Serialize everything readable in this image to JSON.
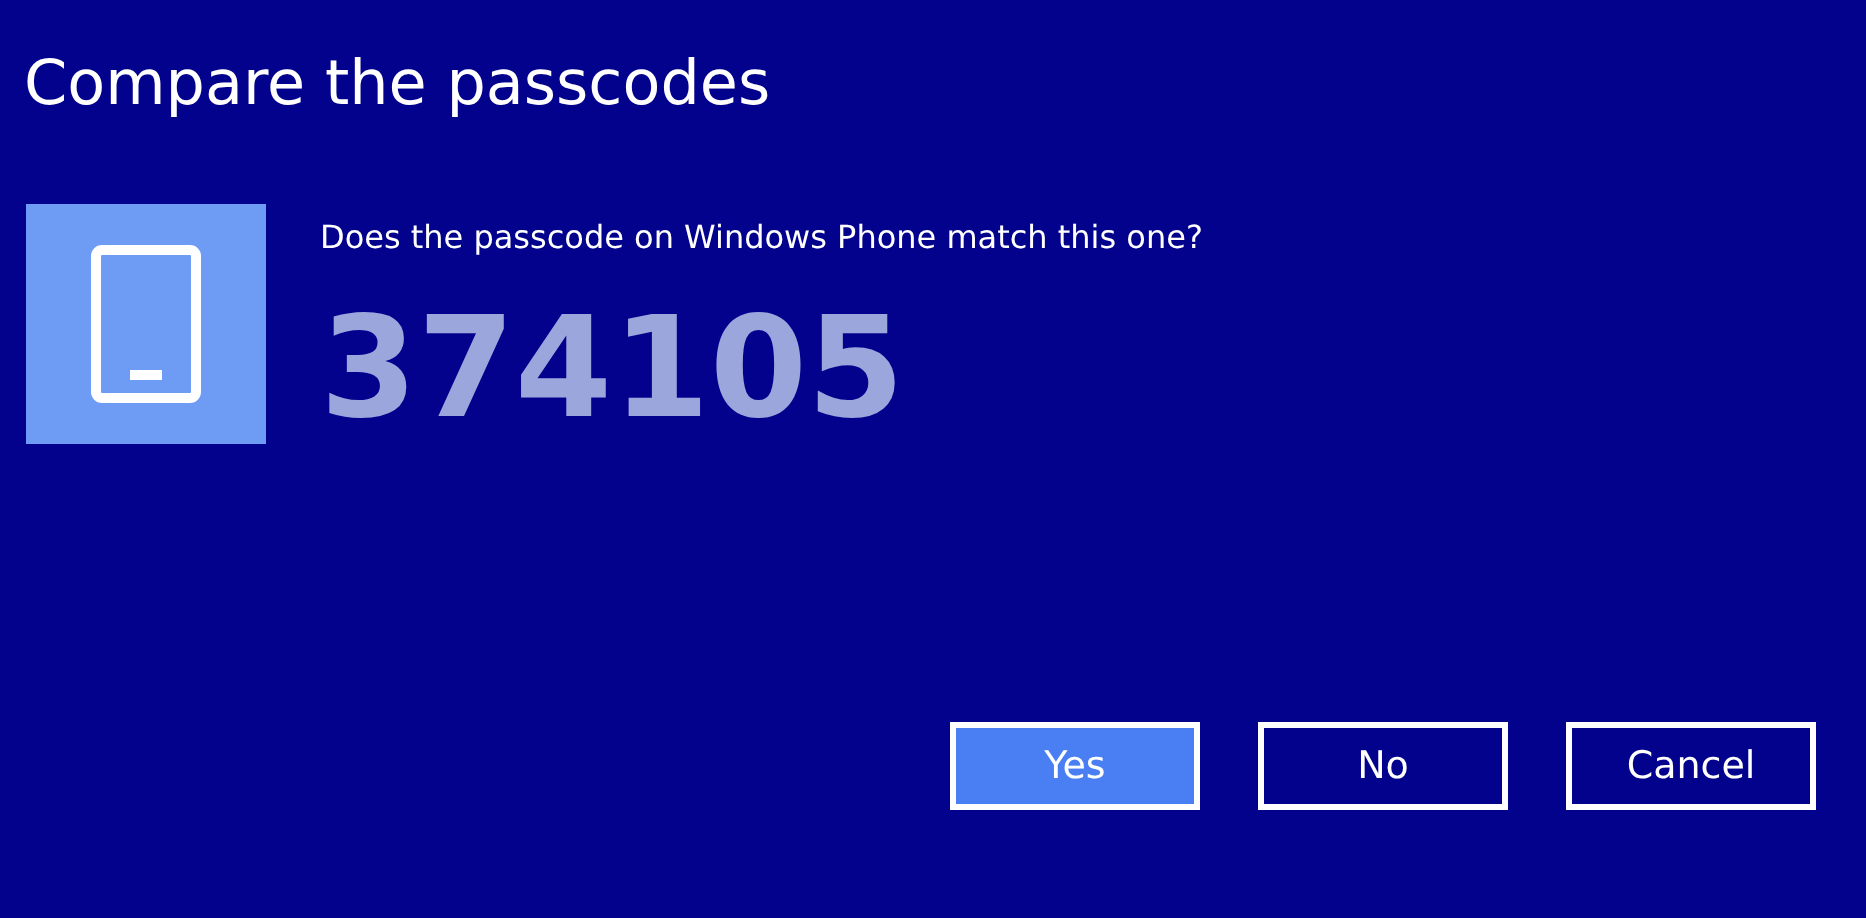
{
  "title": "Compare the passcodes",
  "question": "Does the passcode on Windows Phone match this one?",
  "passcode": "374105",
  "buttons": [
    {
      "label": "Yes",
      "selected": true
    },
    {
      "label": "No",
      "selected": false
    },
    {
      "label": "Cancel",
      "selected": false
    }
  ]
}
